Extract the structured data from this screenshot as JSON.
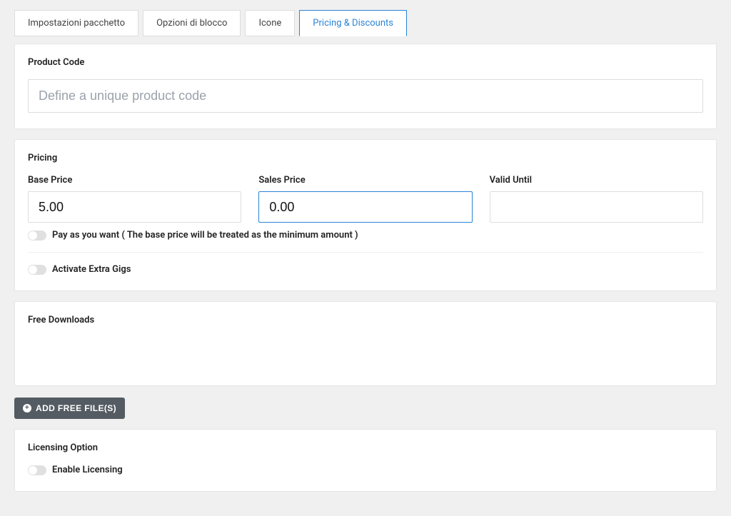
{
  "tabs": {
    "package_settings": "Impostazioni pacchetto",
    "block_options": "Opzioni di blocco",
    "icons": "Icone",
    "pricing_discounts": "Pricing & Discounts"
  },
  "product_code": {
    "title": "Product Code",
    "placeholder": "Define a unique product code",
    "value": ""
  },
  "pricing": {
    "title": "Pricing",
    "base_price_label": "Base Price",
    "base_price_value": "5.00",
    "sales_price_label": "Sales Price",
    "sales_price_value": "0.00",
    "valid_until_label": "Valid Until",
    "valid_until_value": "",
    "pay_as_you_want_label": "Pay as you want ( The base price will be treated as the minimum amount )",
    "activate_extra_gigs_label": "Activate Extra Gigs"
  },
  "free_downloads": {
    "title": "Free Downloads",
    "add_button_label": "Add Free File(s)"
  },
  "licensing": {
    "title": "Licensing Option",
    "enable_label": "Enable Licensing"
  }
}
